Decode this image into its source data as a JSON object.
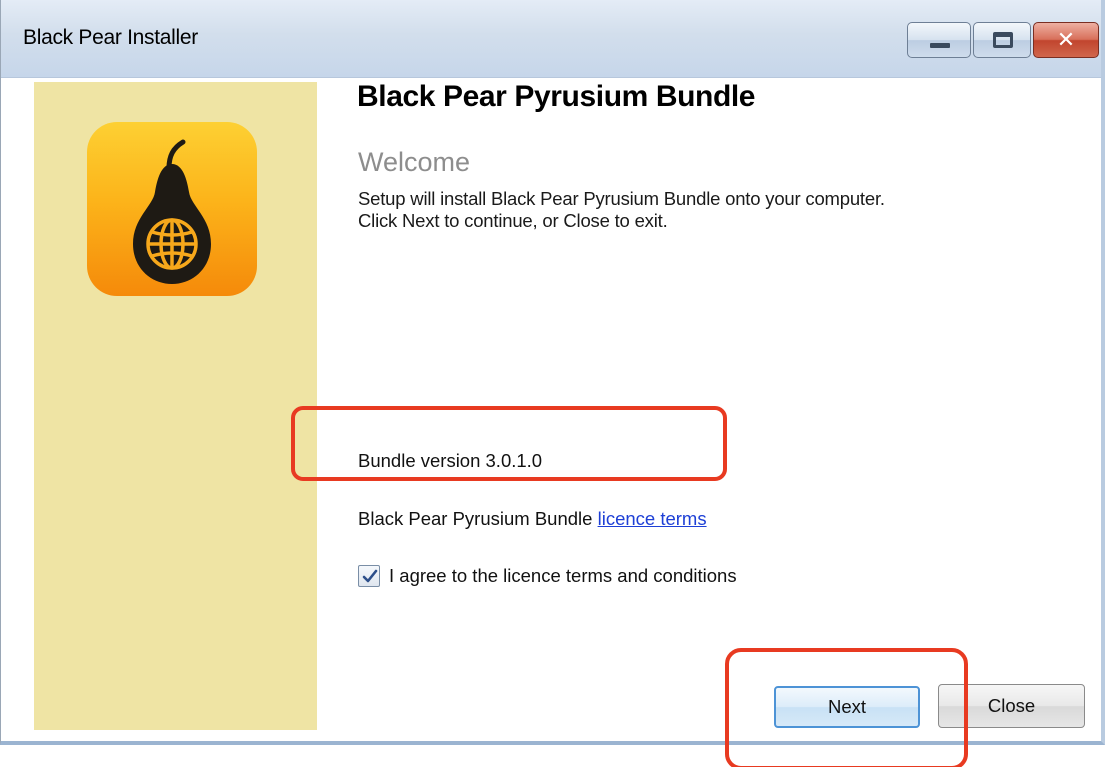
{
  "window": {
    "title": "Black Pear Installer",
    "close_glyph": "✕"
  },
  "content": {
    "product_title": "Black Pear Pyrusium Bundle",
    "welcome_heading": "Welcome",
    "intro_line_1": "Setup will install Black Pear Pyrusium Bundle onto your computer.",
    "intro_line_2": "Click Next to continue, or Close to exit.",
    "version_text": "Bundle version 3.0.1.0",
    "licence_prefix": "Black Pear Pyrusium Bundle ",
    "licence_link": "licence terms",
    "agree_label": "I agree to the licence terms and conditions",
    "agree_checked": true
  },
  "buttons": {
    "next_label": "Next",
    "close_label": "Close"
  },
  "icons": {
    "app_logo": "pear-globe-icon",
    "minimize": "minimize-icon",
    "maximize": "maximize-icon",
    "close": "close-icon",
    "checkbox": "checkmark-icon"
  },
  "colors": {
    "side_panel": "#efe4a4",
    "annotation": "#e83a21",
    "link": "#1d3fd6",
    "welcome": "#8d8d8d"
  }
}
